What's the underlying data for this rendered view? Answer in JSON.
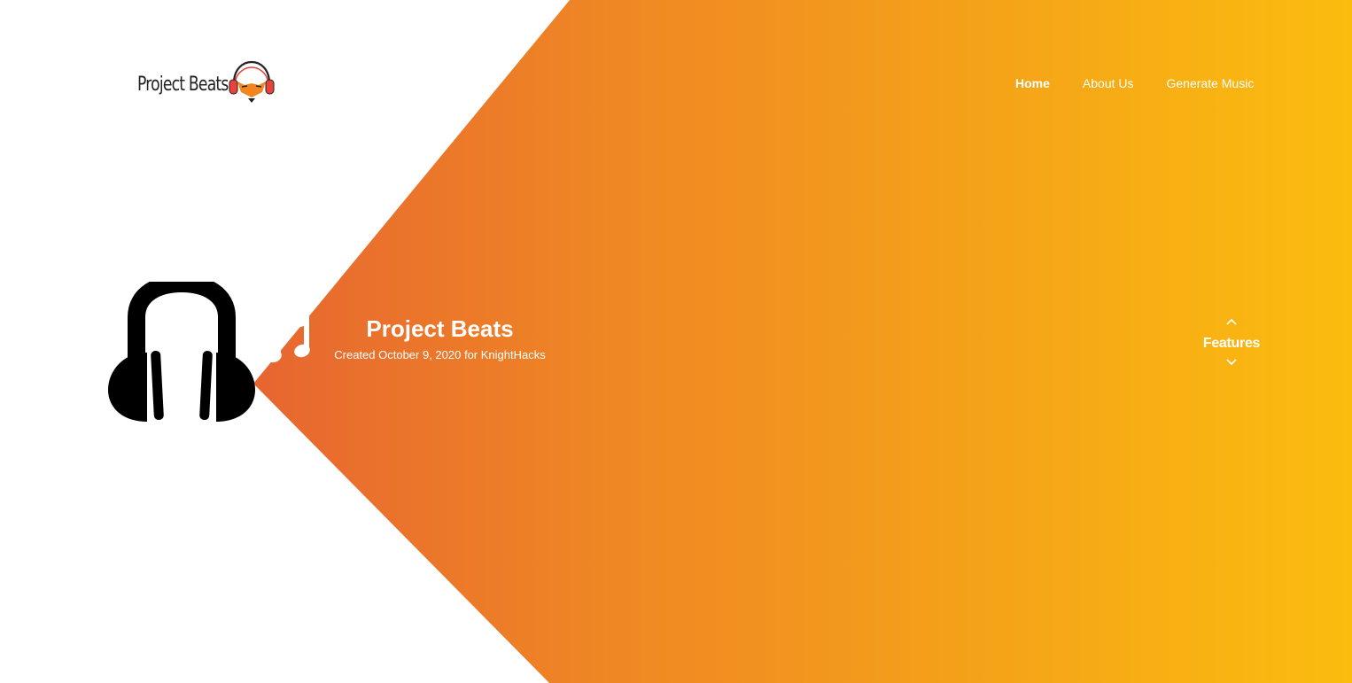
{
  "header": {
    "logo_text": "Project Beats",
    "logo_icon": "headphones-fox-icon"
  },
  "nav": {
    "items": [
      {
        "label": "Home",
        "active": true
      },
      {
        "label": "About Us",
        "active": false
      },
      {
        "label": "Generate Music",
        "active": false
      }
    ]
  },
  "hero": {
    "title": "Project Beats",
    "subtitle": "Created October 9, 2020 for KnightHacks",
    "headphones_icon": "headphones-icon",
    "note_icon": "music-note-icon"
  },
  "features": {
    "label": "Features",
    "up_icon": "chevron-up-icon",
    "down_icon": "chevron-down-icon"
  },
  "colors": {
    "gradient_start": "#e0453b",
    "gradient_mid": "#ef8724",
    "gradient_end": "#fbbc0e",
    "text_light": "#ffffff",
    "text_dark": "#222222"
  }
}
